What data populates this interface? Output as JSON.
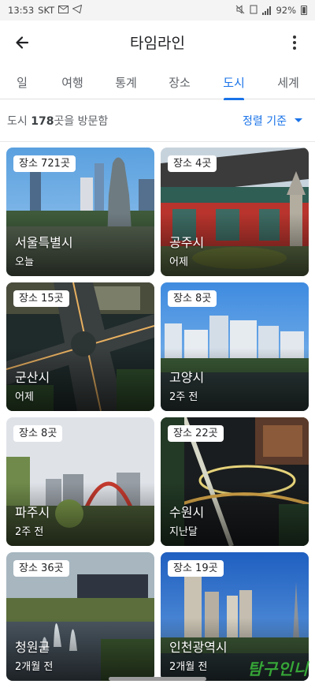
{
  "status_bar": {
    "time": "13:53",
    "carrier": "SKT",
    "battery": "92%"
  },
  "header": {
    "title": "타임라인"
  },
  "tabs": [
    {
      "label": "일"
    },
    {
      "label": "여행"
    },
    {
      "label": "통계"
    },
    {
      "label": "장소"
    },
    {
      "label": "도시",
      "active": true
    },
    {
      "label": "세계"
    }
  ],
  "summary": {
    "prefix": "도시 ",
    "count": "178",
    "suffix": "곳을 방문함",
    "sort_label": "정렬 기준"
  },
  "cities": [
    {
      "badge": "장소 721곳",
      "name": "서울특별시",
      "when": "오늘"
    },
    {
      "badge": "장소 4곳",
      "name": "공주시",
      "when": "어제"
    },
    {
      "badge": "장소 15곳",
      "name": "군산시",
      "when": "어제"
    },
    {
      "badge": "장소 8곳",
      "name": "고양시",
      "when": "2주 전"
    },
    {
      "badge": "장소 8곳",
      "name": "파주시",
      "when": "2주 전"
    },
    {
      "badge": "장소 22곳",
      "name": "수원시",
      "when": "지난달"
    },
    {
      "badge": "장소 36곳",
      "name": "청원군",
      "when": "2개월 전"
    },
    {
      "badge": "장소 19곳",
      "name": "인천광역시",
      "when": "2개월 전"
    }
  ],
  "watermark": "탐구인니",
  "colors": {
    "accent": "#1a73e8",
    "text": "#202124",
    "secondary": "#5f6368"
  }
}
